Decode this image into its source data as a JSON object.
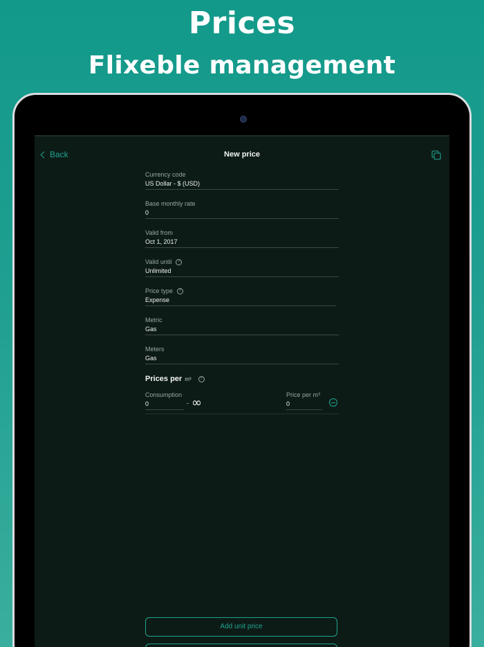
{
  "promo": {
    "title": "Prices",
    "subtitle": "Flixeble management"
  },
  "nav": {
    "back_label": "Back",
    "title": "New price",
    "copy_icon": "copy-icon"
  },
  "form": {
    "fields": [
      {
        "label": "Currency code",
        "value": "US Dollar - $ (USD)",
        "help": false
      },
      {
        "label": "Base monthly rate",
        "value": "0",
        "help": false
      },
      {
        "label": "Valid from",
        "value": "Oct 1, 2017",
        "help": false
      },
      {
        "label": "Valid until",
        "value": "Unlimited",
        "help": true
      },
      {
        "label": "Price type",
        "value": "Expense",
        "help": true
      },
      {
        "label": "Metric",
        "value": "Gas",
        "help": false
      },
      {
        "label": "Meters",
        "value": "Gas",
        "help": false
      }
    ]
  },
  "prices": {
    "title": "Prices per",
    "unit": "m³",
    "tier": {
      "consumption_label": "Consumption",
      "consumption_from": "0",
      "separator": "-",
      "consumption_to": "∞",
      "price_label": "Price per m³",
      "price_value": "0"
    }
  },
  "actions": {
    "add_unit_price": "Add unit price"
  },
  "colors": {
    "accent": "#1fa58f",
    "background_top": "#12998a",
    "screen": "#0d1b17"
  }
}
